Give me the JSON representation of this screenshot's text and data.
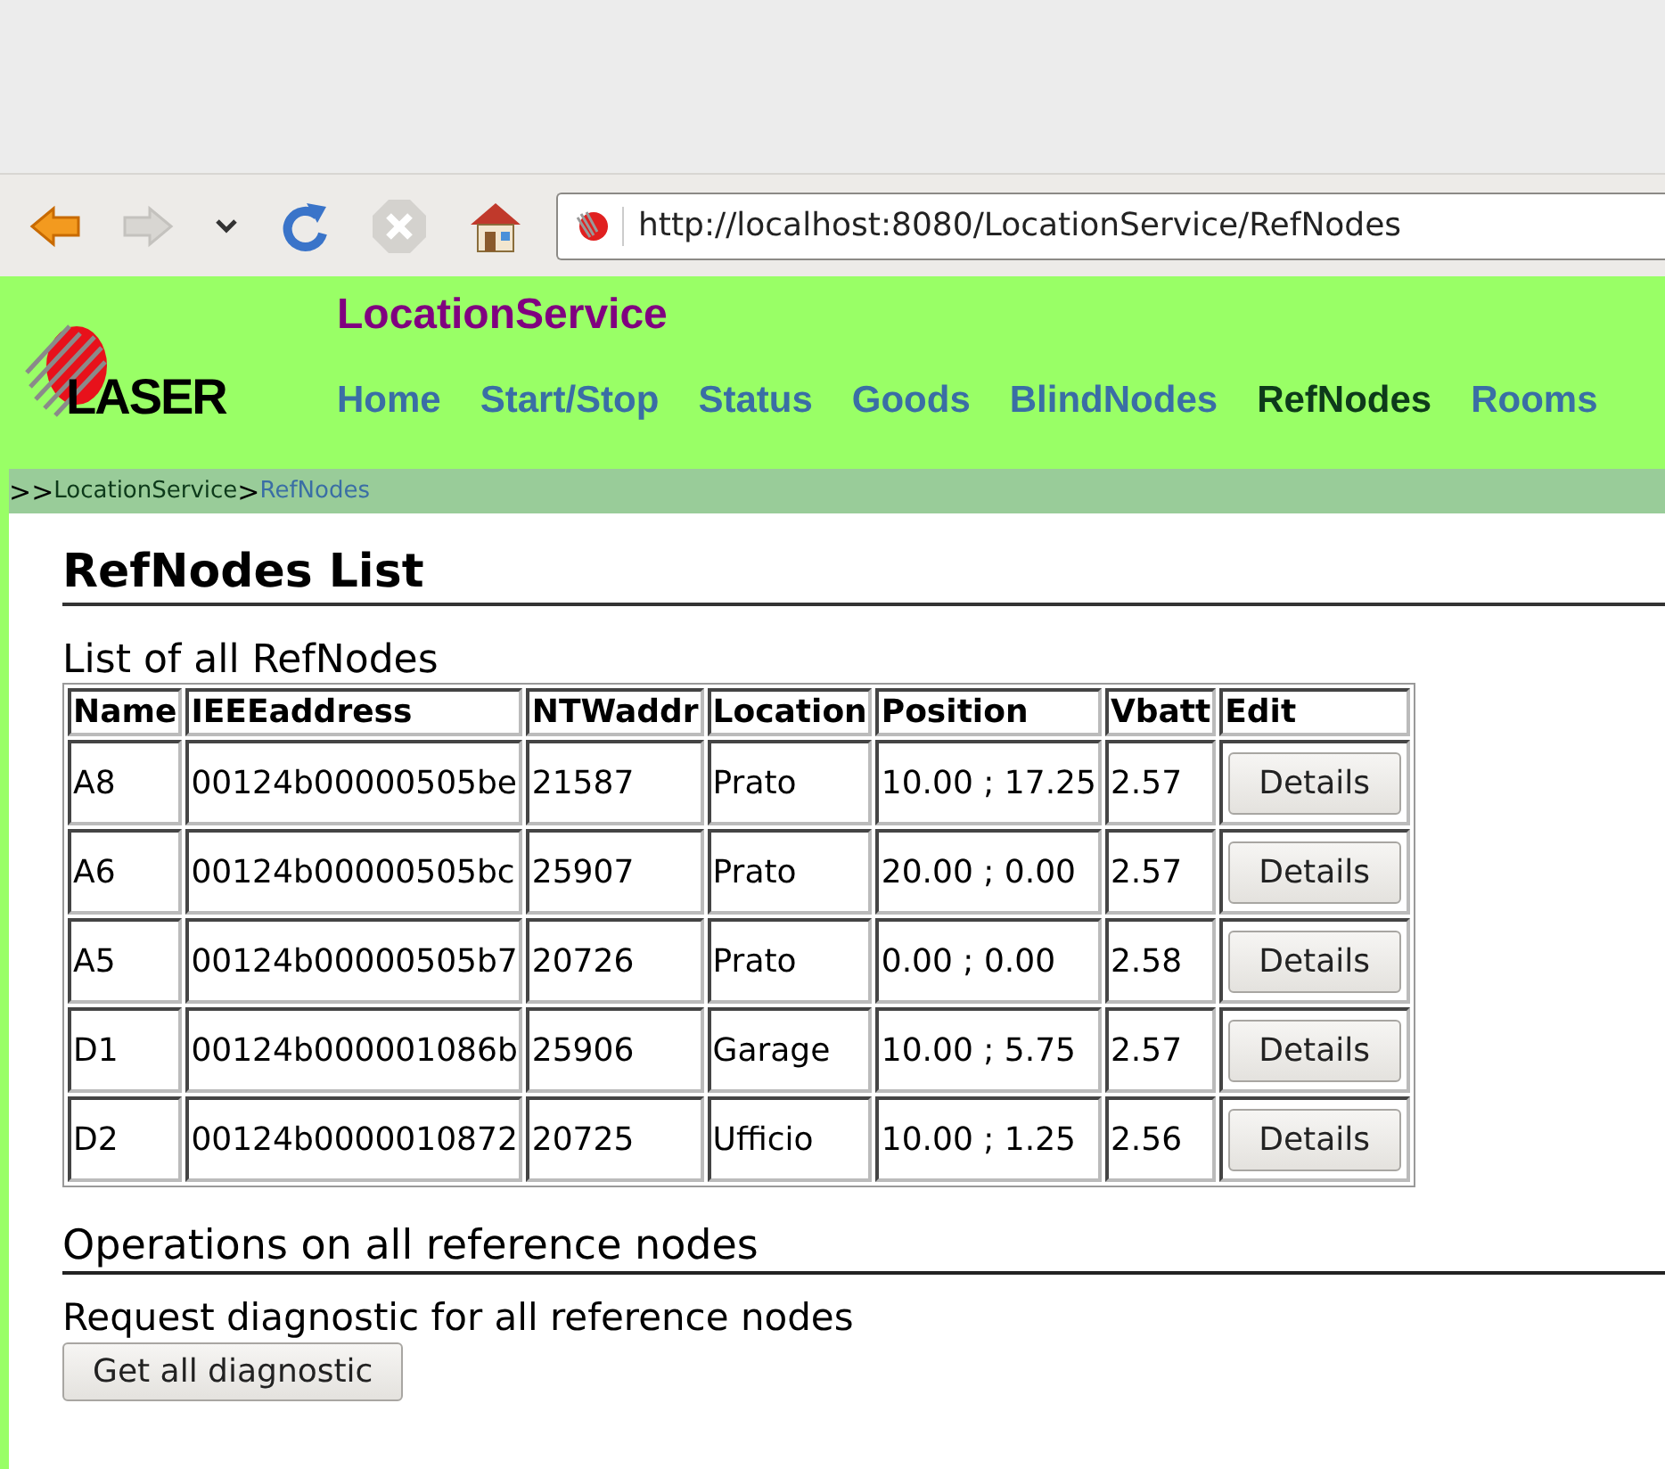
{
  "browser": {
    "url": "http://localhost:8080/LocationService/RefNodes"
  },
  "header": {
    "app_title": "LocationService",
    "logo_text": "LASER",
    "nav": [
      {
        "label": "Home",
        "selected": false
      },
      {
        "label": "Start/Stop",
        "selected": false
      },
      {
        "label": "Status",
        "selected": false
      },
      {
        "label": "Goods",
        "selected": false
      },
      {
        "label": "BlindNodes",
        "selected": false
      },
      {
        "label": "RefNodes",
        "selected": true
      },
      {
        "label": "Rooms",
        "selected": false
      }
    ]
  },
  "breadcrumb": {
    "prefix": ">>",
    "items": [
      "LocationService",
      "RefNodes"
    ],
    "separator": ">"
  },
  "page_title": "RefNodes List",
  "table": {
    "caption": "List of all RefNodes",
    "columns": [
      "Name",
      "IEEEaddress",
      "NTWaddr",
      "Location",
      "Position",
      "Vbatt",
      "Edit"
    ],
    "rows": [
      {
        "cells": [
          "A8",
          "00124b00000505be",
          "21587",
          "Prato",
          "10.00 ; 17.25",
          "2.57"
        ],
        "action": "Details"
      },
      {
        "cells": [
          "A6",
          "00124b00000505bc",
          "25907",
          "Prato",
          "20.00 ; 0.00",
          "2.57"
        ],
        "action": "Details"
      },
      {
        "cells": [
          "A5",
          "00124b00000505b7",
          "20726",
          "Prato",
          "0.00 ; 0.00",
          "2.58"
        ],
        "action": "Details"
      },
      {
        "cells": [
          "D1",
          "00124b000001086b",
          "25906",
          "Garage",
          "10.00 ; 5.75",
          "2.57"
        ],
        "action": "Details"
      },
      {
        "cells": [
          "D2",
          "00124b0000010872",
          "20725",
          "Ufficio",
          "10.00 ; 1.25",
          "2.56"
        ],
        "action": "Details"
      }
    ]
  },
  "operations": {
    "title": "Operations on all reference nodes",
    "description": "Request diagnostic for all reference nodes",
    "button": "Get all diagnostic"
  }
}
